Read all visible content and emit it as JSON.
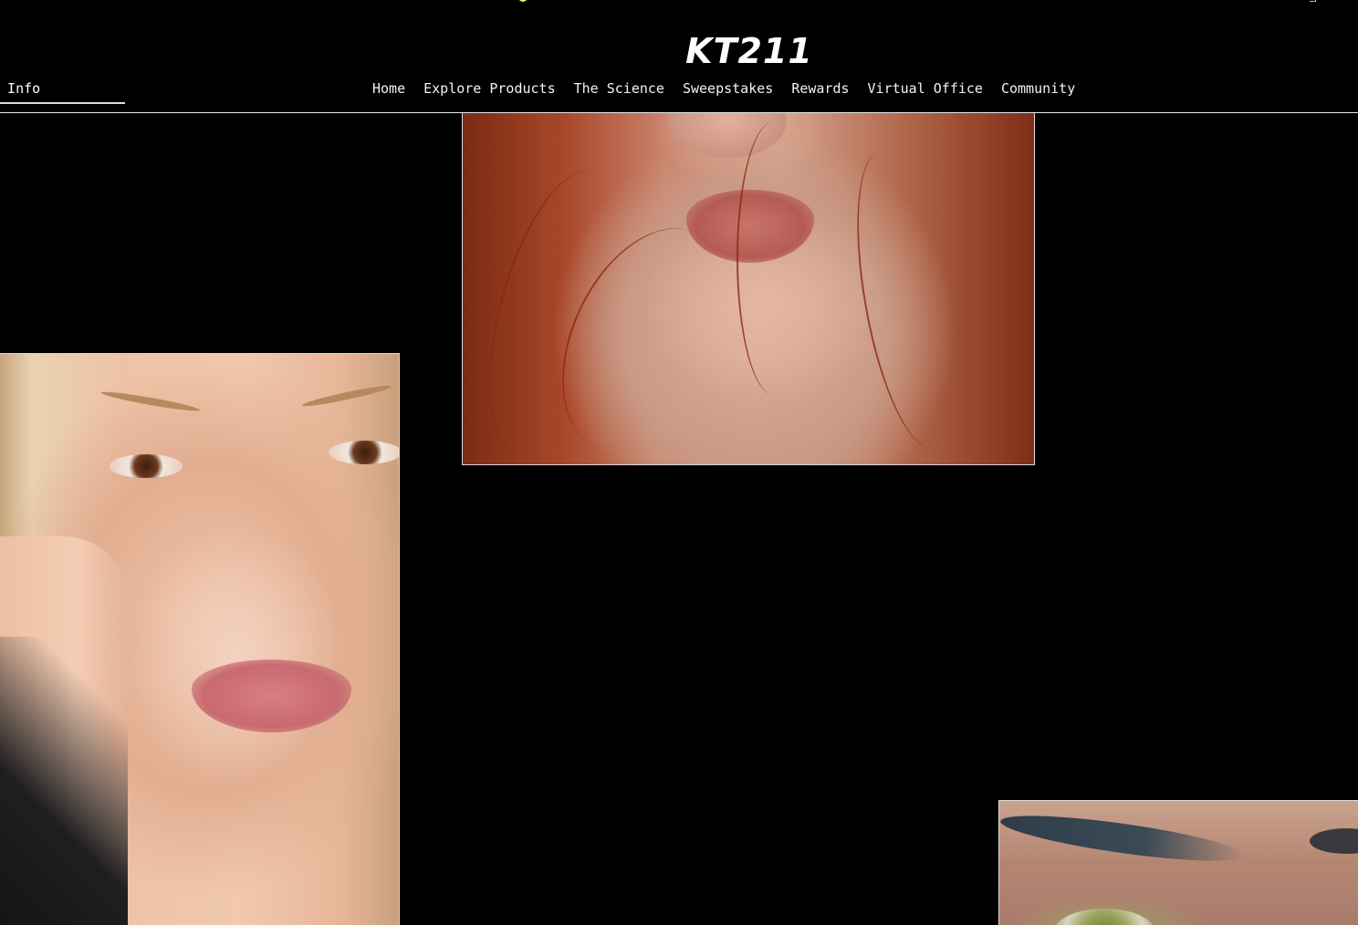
{
  "header": {
    "logo": "KT211",
    "side_link": "& Info",
    "nav": [
      "Home",
      "Explore Products",
      "The Science",
      "Sweepstakes",
      "Rewards",
      "Virtual Office",
      "Community"
    ]
  },
  "gallery": {
    "photos": [
      "red-haired-woman-lips-photo",
      "blonde-woman-hand-on-face-photo",
      "eye-close-up-photo"
    ]
  },
  "colors": {
    "background": "#000000",
    "text": "#ffffff",
    "divider": "#e8e8e8",
    "accent_dot": "#f2f24a"
  }
}
